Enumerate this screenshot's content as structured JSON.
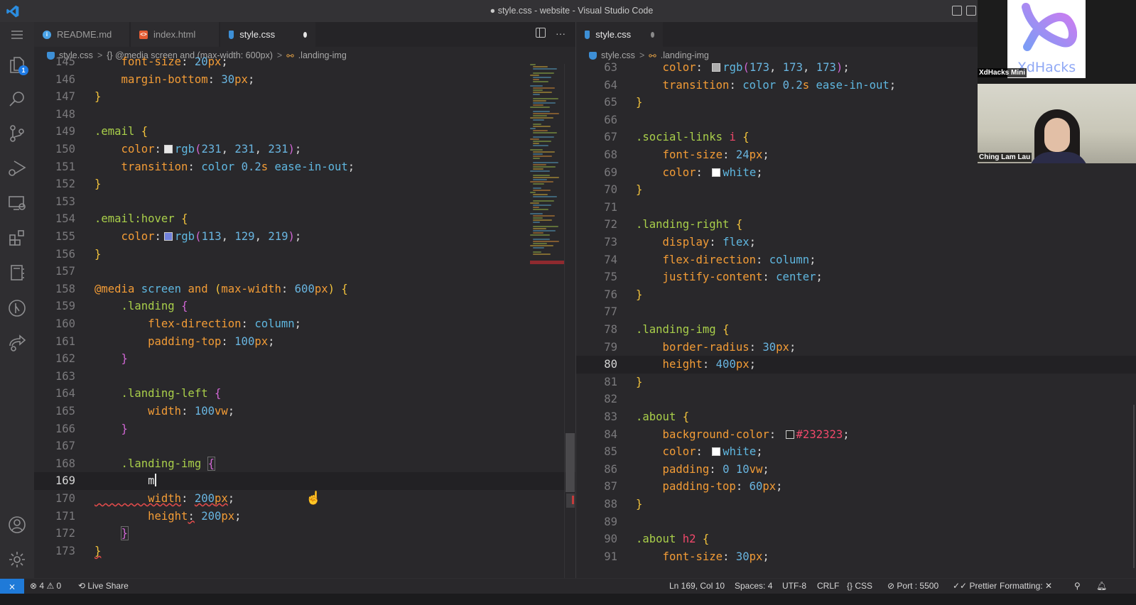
{
  "window": {
    "title": "● style.css - website - Visual Studio Code"
  },
  "zoom": {
    "logo_text": "XdHacks",
    "logo_caption": "XdHacks Mini",
    "participant_name": "Ching Lam Lau"
  },
  "activity_bar": {
    "items": [
      {
        "name": "menu",
        "icon": "hamburger-icon"
      },
      {
        "name": "explorer",
        "icon": "files-icon",
        "badge": "1"
      },
      {
        "name": "search",
        "icon": "search-icon"
      },
      {
        "name": "source-control",
        "icon": "source-control-icon"
      },
      {
        "name": "run-debug",
        "icon": "run-debug-icon"
      },
      {
        "name": "remote-explorer",
        "icon": "remote-explorer-icon"
      },
      {
        "name": "extensions",
        "icon": "extensions-icon"
      },
      {
        "name": "notebook",
        "icon": "notebook-icon"
      },
      {
        "name": "gitlens",
        "icon": "gitlens-icon"
      },
      {
        "name": "live-share",
        "icon": "live-share-icon"
      },
      {
        "name": "accounts",
        "icon": "account-icon"
      },
      {
        "name": "manage",
        "icon": "gear-icon"
      }
    ]
  },
  "left_editor": {
    "tabs": [
      {
        "label": "README.md",
        "icon": "info-icon",
        "active": false
      },
      {
        "label": "index.html",
        "icon": "html-file-icon",
        "active": false
      },
      {
        "label": "style.css",
        "icon": "css-file-icon",
        "active": true,
        "dirty": true
      }
    ],
    "breadcrumb": [
      "style.css",
      "{} @media screen and (max-width: 600px)",
      ".landing-img"
    ],
    "cursor_line": 169,
    "lines": [
      {
        "n": "145",
        "text": "    font-size: 20px;"
      },
      {
        "n": "146",
        "text": "    margin-bottom: 30px;"
      },
      {
        "n": "147",
        "text": "}"
      },
      {
        "n": "148",
        "text": ""
      },
      {
        "n": "149",
        "text": ".email {"
      },
      {
        "n": "150",
        "text": "    color: rgb(231, 231, 231);"
      },
      {
        "n": "151",
        "text": "    transition: color 0.2s ease-in-out;"
      },
      {
        "n": "152",
        "text": "}"
      },
      {
        "n": "153",
        "text": ""
      },
      {
        "n": "154",
        "text": ".email:hover {"
      },
      {
        "n": "155",
        "text": "    color: rgb(113, 129, 219);"
      },
      {
        "n": "156",
        "text": "}"
      },
      {
        "n": "157",
        "text": ""
      },
      {
        "n": "158",
        "text": "@media screen and (max-width: 600px) {"
      },
      {
        "n": "159",
        "text": "    .landing {"
      },
      {
        "n": "160",
        "text": "        flex-direction: column;"
      },
      {
        "n": "161",
        "text": "        padding-top: 100px;"
      },
      {
        "n": "162",
        "text": "    }"
      },
      {
        "n": "163",
        "text": ""
      },
      {
        "n": "164",
        "text": "    .landing-left {"
      },
      {
        "n": "165",
        "text": "        width: 100vw;"
      },
      {
        "n": "166",
        "text": "    }"
      },
      {
        "n": "167",
        "text": ""
      },
      {
        "n": "168",
        "text": "    .landing-img {"
      },
      {
        "n": "169",
        "text": "        m"
      },
      {
        "n": "170",
        "text": "        width: 200px;"
      },
      {
        "n": "171",
        "text": "        height: 200px;"
      },
      {
        "n": "172",
        "text": "    }"
      },
      {
        "n": "173",
        "text": "}"
      }
    ],
    "tokens": {
      "145": [
        [
          "prop",
          "    font-size"
        ],
        [
          "punc",
          ": "
        ],
        [
          "num",
          "20"
        ],
        [
          "unit",
          "px"
        ],
        [
          "punc",
          ";"
        ]
      ],
      "146": [
        [
          "prop",
          "    margin-bottom"
        ],
        [
          "punc",
          ": "
        ],
        [
          "num",
          "30"
        ],
        [
          "unit",
          "px"
        ],
        [
          "punc",
          ";"
        ]
      ],
      "147": [
        [
          "br1",
          "}"
        ]
      ],
      "149": [
        [
          "sel",
          ".email "
        ],
        [
          "br1",
          "{"
        ]
      ],
      "150": [
        [
          "prop",
          "    color"
        ],
        [
          "punc",
          ":"
        ],
        [
          "swatch",
          "#e7e7e7"
        ],
        [
          "val",
          "rgb"
        ],
        [
          "paren",
          "("
        ],
        [
          "num",
          "231"
        ],
        [
          "punc",
          ", "
        ],
        [
          "num",
          "231"
        ],
        [
          "punc",
          ", "
        ],
        [
          "num",
          "231"
        ],
        [
          "paren",
          ")"
        ],
        [
          "punc",
          ";"
        ]
      ],
      "151": [
        [
          "prop",
          "    transition"
        ],
        [
          "punc",
          ": "
        ],
        [
          "val",
          "color "
        ],
        [
          "num",
          "0.2"
        ],
        [
          "unit",
          "s"
        ],
        [
          "val",
          " ease-in-out"
        ],
        [
          "punc",
          ";"
        ]
      ],
      "152": [
        [
          "br1",
          "}"
        ]
      ],
      "154": [
        [
          "sel",
          ".email:hover "
        ],
        [
          "br1",
          "{"
        ]
      ],
      "155": [
        [
          "prop",
          "    color"
        ],
        [
          "punc",
          ":"
        ],
        [
          "swatch",
          "#7181db"
        ],
        [
          "val",
          "rgb"
        ],
        [
          "paren",
          "("
        ],
        [
          "num",
          "113"
        ],
        [
          "punc",
          ", "
        ],
        [
          "num",
          "129"
        ],
        [
          "punc",
          ", "
        ],
        [
          "num",
          "219"
        ],
        [
          "paren",
          ")"
        ],
        [
          "punc",
          ";"
        ]
      ],
      "156": [
        [
          "br1",
          "}"
        ]
      ],
      "158": [
        [
          "kw",
          "@media "
        ],
        [
          "val",
          "screen "
        ],
        [
          "kw",
          "and "
        ],
        [
          "br1",
          "("
        ],
        [
          "kw",
          "max-width"
        ],
        [
          "punc",
          ": "
        ],
        [
          "num",
          "600"
        ],
        [
          "unit",
          "px"
        ],
        [
          "br1",
          ") {"
        ]
      ],
      "159": [
        [
          "sel",
          "    .landing "
        ],
        [
          "br2",
          "{"
        ]
      ],
      "160": [
        [
          "prop",
          "        flex-direction"
        ],
        [
          "punc",
          ": "
        ],
        [
          "val",
          "column"
        ],
        [
          "punc",
          ";"
        ]
      ],
      "161": [
        [
          "prop",
          "        padding-top"
        ],
        [
          "punc",
          ": "
        ],
        [
          "num",
          "100"
        ],
        [
          "unit",
          "px"
        ],
        [
          "punc",
          ";"
        ]
      ],
      "162": [
        [
          "br2",
          "    }"
        ]
      ],
      "164": [
        [
          "sel",
          "    .landing-left "
        ],
        [
          "br2",
          "{"
        ]
      ],
      "165": [
        [
          "prop",
          "        width"
        ],
        [
          "punc",
          ": "
        ],
        [
          "num",
          "100"
        ],
        [
          "unit",
          "vw"
        ],
        [
          "punc",
          ";"
        ]
      ],
      "166": [
        [
          "br2",
          "    }"
        ]
      ],
      "168": [
        [
          "sel",
          "    .landing-img "
        ],
        [
          "br2box",
          "{"
        ]
      ],
      "169": [
        [
          "plain",
          "        m"
        ],
        [
          "cursor",
          ""
        ]
      ],
      "170": [
        [
          "propsq",
          "        width"
        ],
        [
          "punc",
          ": "
        ],
        [
          "numsq",
          "200"
        ],
        [
          "unitsq",
          "px"
        ],
        [
          "punc",
          ";"
        ]
      ],
      "171": [
        [
          "prop",
          "        height"
        ],
        [
          "punctsq",
          ":"
        ],
        [
          "punc",
          " "
        ],
        [
          "num",
          "200"
        ],
        [
          "unit",
          "px"
        ],
        [
          "punc",
          ";"
        ]
      ],
      "172": [
        [
          "plain",
          "    "
        ],
        [
          "br2box",
          "}"
        ]
      ],
      "173": [
        [
          "br1sq",
          "}"
        ]
      ]
    }
  },
  "right_editor": {
    "tabs": [
      {
        "label": "style.css",
        "icon": "css-file-icon",
        "active": true,
        "dirty": true
      }
    ],
    "breadcrumb": [
      "style.css",
      ".landing-img"
    ],
    "cursor_line": 80,
    "lines": [
      {
        "n": "63",
        "text": "    color: rgb(173, 173, 173);"
      },
      {
        "n": "64",
        "text": "    transition: color 0.2s ease-in-out;"
      },
      {
        "n": "65",
        "text": "}"
      },
      {
        "n": "66",
        "text": ""
      },
      {
        "n": "67",
        "text": ".social-links i {"
      },
      {
        "n": "68",
        "text": "    font-size: 24px;"
      },
      {
        "n": "69",
        "text": "    color: white;"
      },
      {
        "n": "70",
        "text": "}"
      },
      {
        "n": "71",
        "text": ""
      },
      {
        "n": "72",
        "text": ".landing-right {"
      },
      {
        "n": "73",
        "text": "    display: flex;"
      },
      {
        "n": "74",
        "text": "    flex-direction: column;"
      },
      {
        "n": "75",
        "text": "    justify-content: center;"
      },
      {
        "n": "76",
        "text": "}"
      },
      {
        "n": "77",
        "text": ""
      },
      {
        "n": "78",
        "text": ".landing-img {"
      },
      {
        "n": "79",
        "text": "    border-radius: 30px;"
      },
      {
        "n": "80",
        "text": "    height: 400px;"
      },
      {
        "n": "81",
        "text": "}"
      },
      {
        "n": "82",
        "text": ""
      },
      {
        "n": "83",
        "text": ".about {"
      },
      {
        "n": "84",
        "text": "    background-color: #232323;"
      },
      {
        "n": "85",
        "text": "    color: white;"
      },
      {
        "n": "86",
        "text": "    padding: 0 10vw;"
      },
      {
        "n": "87",
        "text": "    padding-top: 60px;"
      },
      {
        "n": "88",
        "text": "}"
      },
      {
        "n": "89",
        "text": ""
      },
      {
        "n": "90",
        "text": ".about h2 {"
      },
      {
        "n": "91",
        "text": "    font-size: 30px;"
      }
    ],
    "tokens": {
      "63": [
        [
          "prop",
          "    color"
        ],
        [
          "punc",
          ": "
        ],
        [
          "swatch",
          "#adadad"
        ],
        [
          "val",
          "rgb"
        ],
        [
          "paren",
          "("
        ],
        [
          "num",
          "173"
        ],
        [
          "punc",
          ", "
        ],
        [
          "num",
          "173"
        ],
        [
          "punc",
          ", "
        ],
        [
          "num",
          "173"
        ],
        [
          "paren",
          ")"
        ],
        [
          "punc",
          ";"
        ]
      ],
      "64": [
        [
          "prop",
          "    transition"
        ],
        [
          "punc",
          ": "
        ],
        [
          "val",
          "color "
        ],
        [
          "num",
          "0.2"
        ],
        [
          "unit",
          "s"
        ],
        [
          "val",
          " ease-in-out"
        ],
        [
          "punc",
          ";"
        ]
      ],
      "65": [
        [
          "br1",
          "}"
        ]
      ],
      "67": [
        [
          "sel",
          ".social-links "
        ],
        [
          "tag",
          "i "
        ],
        [
          "br1",
          "{"
        ]
      ],
      "68": [
        [
          "prop",
          "    font-size"
        ],
        [
          "punc",
          ": "
        ],
        [
          "num",
          "24"
        ],
        [
          "unit",
          "px"
        ],
        [
          "punc",
          ";"
        ]
      ],
      "69": [
        [
          "prop",
          "    color"
        ],
        [
          "punc",
          ": "
        ],
        [
          "swatch",
          "#ffffff"
        ],
        [
          "val",
          "white"
        ],
        [
          "punc",
          ";"
        ]
      ],
      "70": [
        [
          "br1",
          "}"
        ]
      ],
      "72": [
        [
          "sel",
          ".landing-right "
        ],
        [
          "br1",
          "{"
        ]
      ],
      "73": [
        [
          "prop",
          "    display"
        ],
        [
          "punc",
          ": "
        ],
        [
          "val",
          "flex"
        ],
        [
          "punc",
          ";"
        ]
      ],
      "74": [
        [
          "prop",
          "    flex-direction"
        ],
        [
          "punc",
          ": "
        ],
        [
          "val",
          "column"
        ],
        [
          "punc",
          ";"
        ]
      ],
      "75": [
        [
          "prop",
          "    justify-content"
        ],
        [
          "punc",
          ": "
        ],
        [
          "val",
          "center"
        ],
        [
          "punc",
          ";"
        ]
      ],
      "76": [
        [
          "br1",
          "}"
        ]
      ],
      "78": [
        [
          "sel",
          ".landing-img "
        ],
        [
          "br1",
          "{"
        ]
      ],
      "79": [
        [
          "prop",
          "    border-radius"
        ],
        [
          "punc",
          ": "
        ],
        [
          "num",
          "30"
        ],
        [
          "unit",
          "px"
        ],
        [
          "punc",
          ";"
        ]
      ],
      "80": [
        [
          "prop",
          "    height"
        ],
        [
          "punc",
          ": "
        ],
        [
          "num",
          "400"
        ],
        [
          "unit",
          "px"
        ],
        [
          "punc",
          ";"
        ]
      ],
      "81": [
        [
          "br1",
          "}"
        ]
      ],
      "83": [
        [
          "sel",
          ".about "
        ],
        [
          "br1",
          "{"
        ]
      ],
      "84": [
        [
          "prop",
          "    background-color"
        ],
        [
          "punc",
          ": "
        ],
        [
          "swatch",
          "#232323"
        ],
        [
          "hex",
          "#232323"
        ],
        [
          "punc",
          ";"
        ]
      ],
      "85": [
        [
          "prop",
          "    color"
        ],
        [
          "punc",
          ": "
        ],
        [
          "swatch",
          "#ffffff"
        ],
        [
          "val",
          "white"
        ],
        [
          "punc",
          ";"
        ]
      ],
      "86": [
        [
          "prop",
          "    padding"
        ],
        [
          "punc",
          ": "
        ],
        [
          "num",
          "0 10"
        ],
        [
          "unit",
          "vw"
        ],
        [
          "punc",
          ";"
        ]
      ],
      "87": [
        [
          "prop",
          "    padding-top"
        ],
        [
          "punc",
          ": "
        ],
        [
          "num",
          "60"
        ],
        [
          "unit",
          "px"
        ],
        [
          "punc",
          ";"
        ]
      ],
      "88": [
        [
          "br1",
          "}"
        ]
      ],
      "90": [
        [
          "sel",
          ".about "
        ],
        [
          "tag",
          "h2 "
        ],
        [
          "br1",
          "{"
        ]
      ],
      "91": [
        [
          "prop",
          "    font-size"
        ],
        [
          "punc",
          ": "
        ],
        [
          "num",
          "30"
        ],
        [
          "unit",
          "px"
        ],
        [
          "punc",
          ";"
        ]
      ]
    }
  },
  "status_bar": {
    "remote_icon": "remote-icon",
    "errors": "4",
    "warnings": "0",
    "live_share": "Live Share",
    "cursor_position": "Ln 169, Col 10",
    "spaces": "Spaces: 4",
    "encoding": "UTF-8",
    "line_ending": "CRLF",
    "language": "CSS",
    "port": "Port : 5500",
    "prettier": "Prettier",
    "formatting": "Formatting: ✕"
  },
  "colors": {
    "accent_blue": "#1f7ad8",
    "selector": "#a9cf4a",
    "property": "#f39c36",
    "value": "#5fb7e0",
    "bracket_level1": "#f3c33c",
    "bracket_level2": "#d267d6",
    "hex_tag": "#f0486a"
  }
}
